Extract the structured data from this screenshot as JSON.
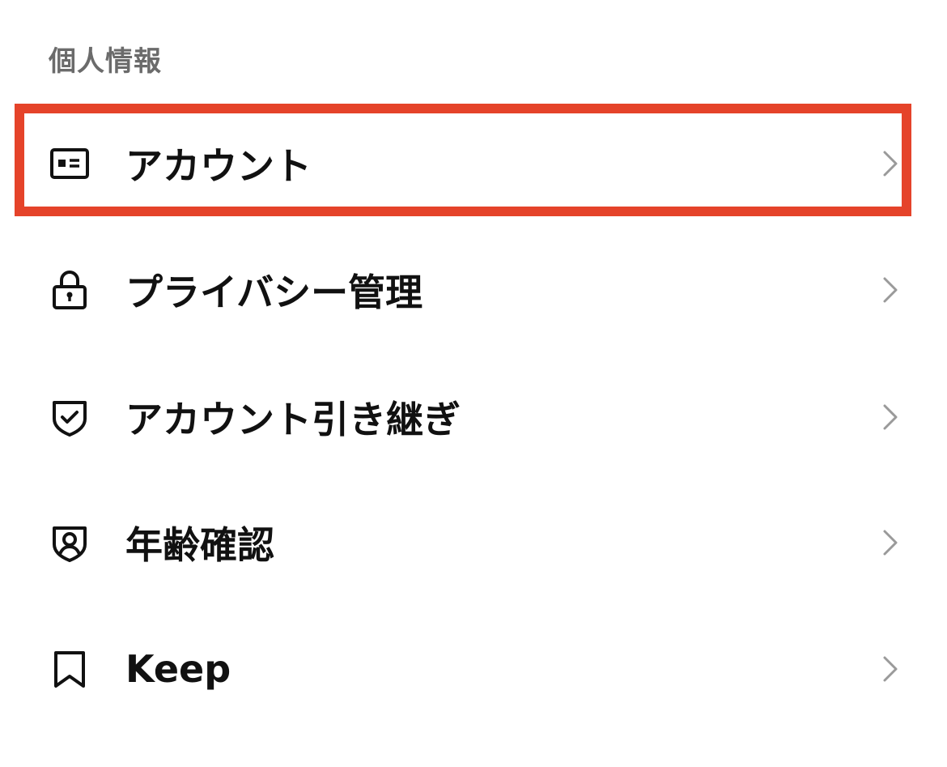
{
  "section": {
    "title": "個人情報"
  },
  "items": [
    {
      "label": "アカウント",
      "icon": "id-card-icon"
    },
    {
      "label": "プライバシー管理",
      "icon": "lock-icon"
    },
    {
      "label": "アカウント引き継ぎ",
      "icon": "shield-check-icon"
    },
    {
      "label": "年齢確認",
      "icon": "shield-user-icon"
    },
    {
      "label": "Keep",
      "icon": "bookmark-icon"
    }
  ],
  "colors": {
    "highlight": "#e5432a",
    "header_text": "#6b6b6b",
    "label_text": "#111111",
    "chevron": "#9a9a9a"
  }
}
